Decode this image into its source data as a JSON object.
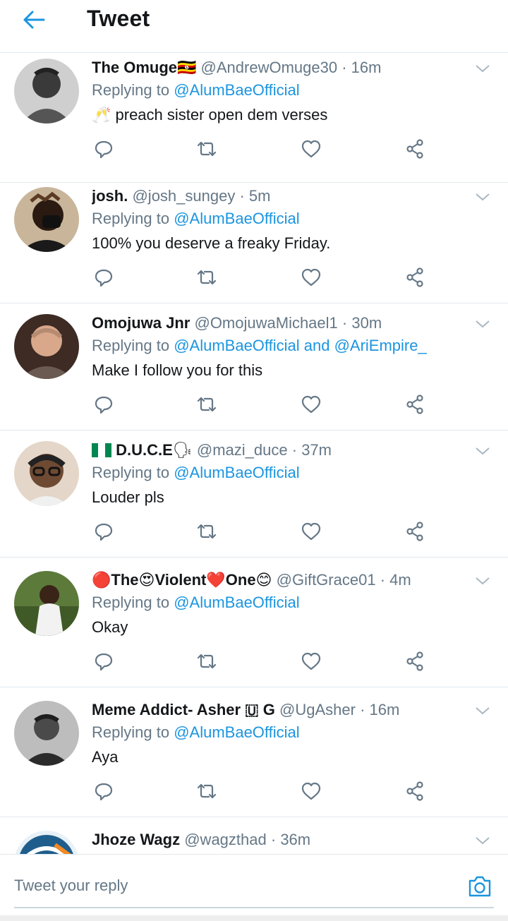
{
  "header": {
    "title": "Tweet",
    "back_icon": "arrow-left-icon"
  },
  "colors": {
    "accent": "#1b95e0",
    "text": "#14171a",
    "secondary": "#657786",
    "divider": "#e1e8ed"
  },
  "tweets": [
    {
      "name": "The Omuge",
      "name_suffix": "🇺🇬",
      "handle": "@AndrewOmuge30",
      "separator": "·",
      "time": "16m",
      "replying_prefix": "Replying to",
      "mentions": "@AlumBaeOfficial",
      "text": "🥂 preach sister open dem verses"
    },
    {
      "name": "josh.",
      "name_suffix": "",
      "handle": "@josh_sungey",
      "separator": "·",
      "time": "5m",
      "replying_prefix": "Replying to",
      "mentions": "@AlumBaeOfficial",
      "text": "100% you deserve a freaky Friday."
    },
    {
      "name": "Omojuwa Jnr",
      "name_suffix": "",
      "handle": "@OmojuwaMichael1",
      "separator": "·",
      "time": "30m",
      "replying_prefix": "Replying to",
      "mentions": "@AlumBaeOfficial and @AriEmpire_",
      "text": "Make I follow you for this"
    },
    {
      "name": "D.U.C.E",
      "name_prefix": "🇳🇬",
      "name_suffix": "🗣",
      "handle": "@mazi_duce",
      "separator": "·",
      "time": "37m",
      "replying_prefix": "Replying to",
      "mentions": "@AlumBaeOfficial",
      "text": "Louder pls"
    },
    {
      "name": "🔴The😍Violent❤️One😊",
      "name_suffix": "",
      "handle": "@GiftGrace01",
      "separator": "·",
      "time": "4m",
      "replying_prefix": "Replying to",
      "mentions": "@AlumBaeOfficial",
      "text": "Okay"
    },
    {
      "name": "Meme Addict- Asher 🇺 G",
      "name_suffix": "",
      "handle": "@UgAsher",
      "separator": "·",
      "time": "16m",
      "replying_prefix": "Replying to",
      "mentions": "@AlumBaeOfficial",
      "text": "Aya"
    },
    {
      "name": "Jhoze Wagz",
      "name_suffix": "",
      "handle": "@wagzthad",
      "separator": "·",
      "time": "36m"
    }
  ],
  "action_icons": [
    "reply-icon",
    "retweet-icon",
    "like-icon",
    "share-icon"
  ],
  "reply_bar": {
    "placeholder": "Tweet your reply",
    "camera_icon": "camera-icon"
  }
}
